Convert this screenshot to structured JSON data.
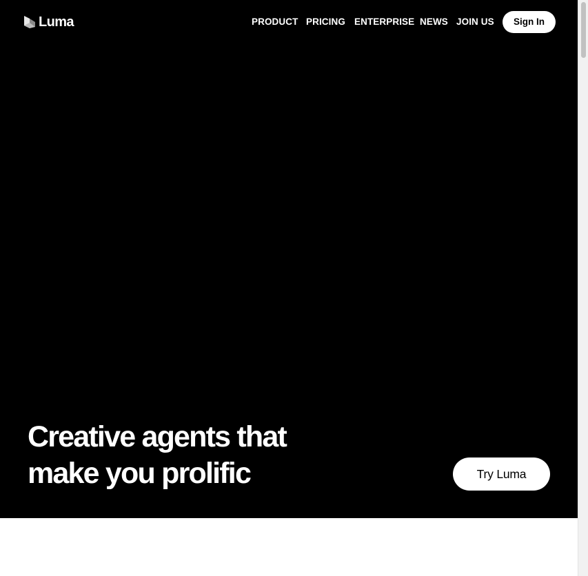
{
  "brand": {
    "name": "Luma",
    "logo_icon": "luma-cube-icon"
  },
  "nav": {
    "items": [
      {
        "label": "PRODUCT"
      },
      {
        "label": "PRICING"
      },
      {
        "label": "ENTERPRISE"
      },
      {
        "label": "NEWS"
      },
      {
        "label": "JOIN US"
      }
    ],
    "signin_label": "Sign In"
  },
  "hero": {
    "headline_line1": "Creative agents that",
    "headline_line2": "make you prolific",
    "cta_label": "Try Luma"
  },
  "colors": {
    "hero_background": "#000000",
    "page_background": "#ffffff",
    "text_on_dark": "#ffffff",
    "button_background": "#ffffff",
    "button_text": "#000000"
  }
}
